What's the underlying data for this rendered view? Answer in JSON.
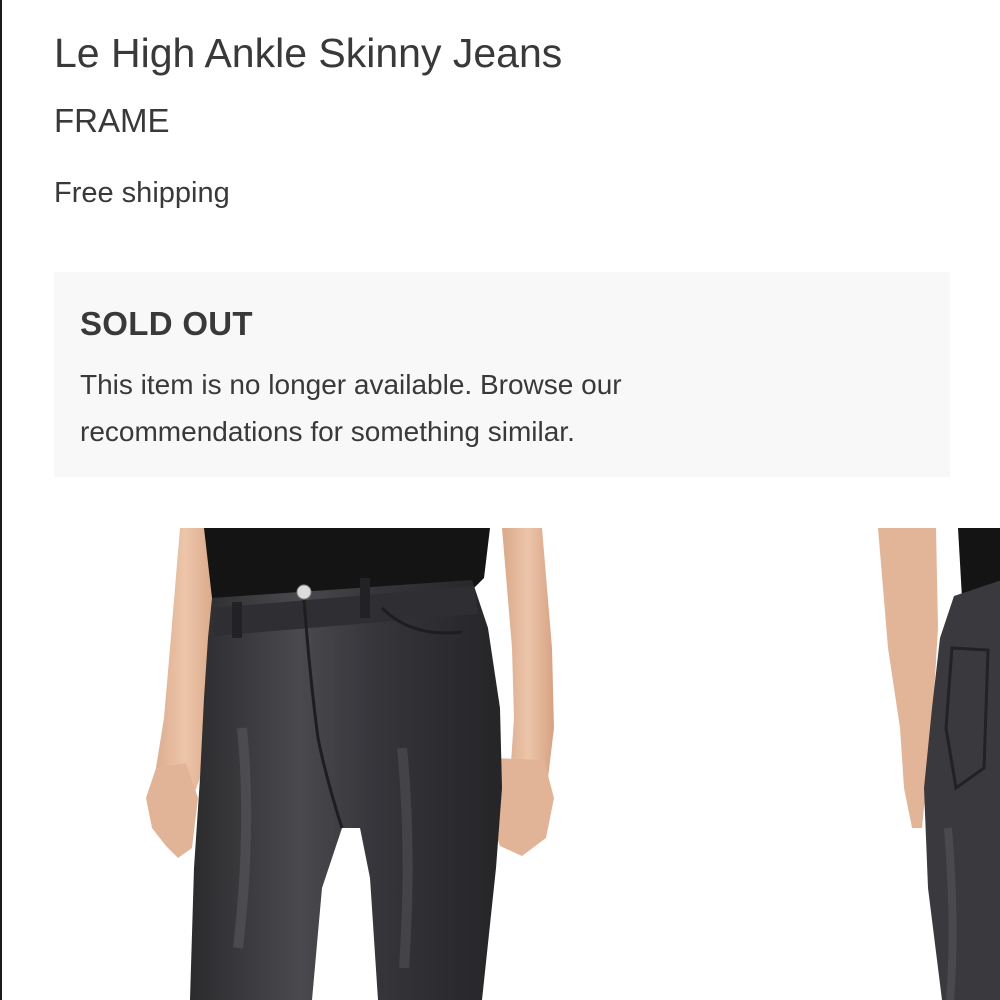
{
  "product": {
    "title": "Le High Ankle Skinny Jeans",
    "brand": "FRAME",
    "shipping": "Free shipping"
  },
  "availability": {
    "status": "SOLD OUT",
    "message": "This item is no longer available. Browse our recommendations for something similar."
  },
  "gallery": {
    "images": [
      {
        "view": "front",
        "subject": "model wearing coated black skinny jeans with black top"
      },
      {
        "view": "back",
        "subject": "model wearing coated black skinny jeans, rear view"
      }
    ]
  },
  "colors": {
    "text": "#393939",
    "notice_background": "#f8f8f8",
    "jeans": "#3a3a3c",
    "top": "#141414",
    "skin": "#e6b99c"
  }
}
